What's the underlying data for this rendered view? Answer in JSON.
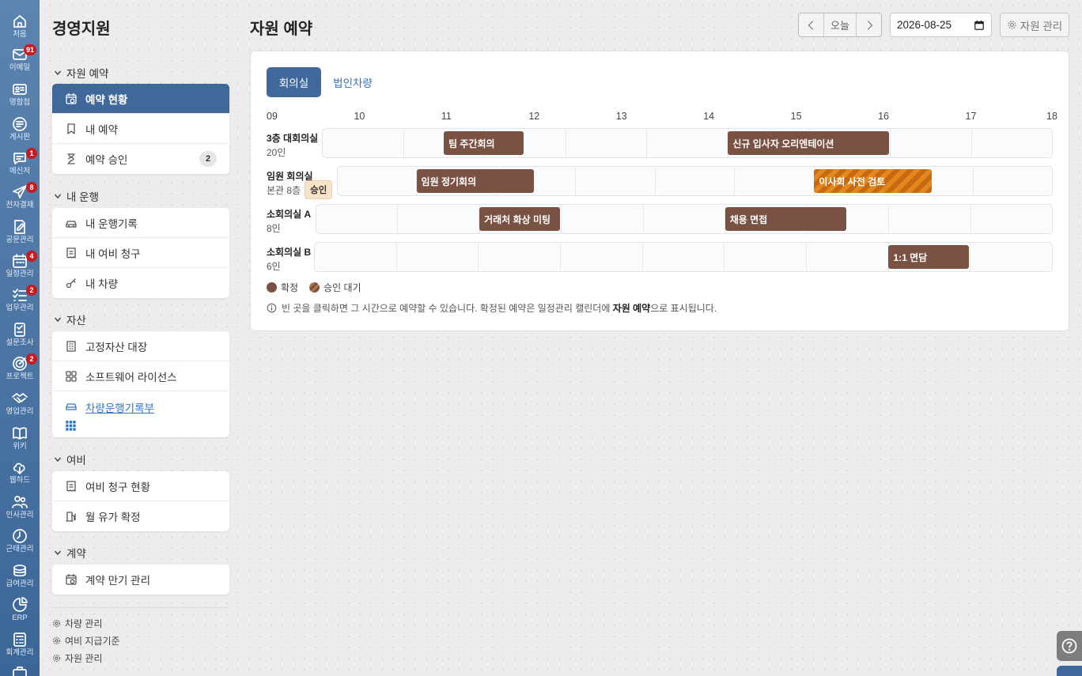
{
  "rail": [
    {
      "label": "처음",
      "icon": "home-icon",
      "badge": ""
    },
    {
      "label": "이메일",
      "icon": "mail-icon",
      "badge": "91"
    },
    {
      "label": "명함첩",
      "icon": "contact-card-icon",
      "badge": ""
    },
    {
      "label": "게시판",
      "icon": "board-icon",
      "badge": ""
    },
    {
      "label": "메신저",
      "icon": "messenger-icon",
      "badge": "1"
    },
    {
      "label": "전자결재",
      "icon": "paper-plane-icon",
      "badge": "8"
    },
    {
      "label": "공문관리",
      "icon": "document-edit-icon",
      "badge": ""
    },
    {
      "label": "일정관리",
      "icon": "calendar-icon",
      "badge": "4"
    },
    {
      "label": "업무관리",
      "icon": "task-list-icon",
      "badge": "2"
    },
    {
      "label": "설문조사",
      "icon": "survey-icon",
      "badge": ""
    },
    {
      "label": "프로젝트",
      "icon": "target-icon",
      "badge": "2"
    },
    {
      "label": "영업관리",
      "icon": "handshake-icon",
      "badge": ""
    },
    {
      "label": "위키",
      "icon": "book-icon",
      "badge": ""
    },
    {
      "label": "웹하드",
      "icon": "cloud-icon",
      "badge": ""
    },
    {
      "label": "인사관리",
      "icon": "people-icon",
      "badge": ""
    },
    {
      "label": "근태관리",
      "icon": "clock-icon",
      "badge": ""
    },
    {
      "label": "급여관리",
      "icon": "coins-icon",
      "badge": ""
    },
    {
      "label": "ERP",
      "icon": "pie-chart-icon",
      "badge": ""
    },
    {
      "label": "회계관리",
      "icon": "calculator-icon",
      "badge": ""
    }
  ],
  "sidebar": {
    "title": "경영지원",
    "groups": [
      {
        "label": "자원 예약",
        "items": [
          {
            "label": "예약 현황",
            "count": ""
          },
          {
            "label": "내 예약",
            "count": ""
          },
          {
            "label": "예약 승인",
            "count": "2"
          }
        ]
      },
      {
        "label": "내 운행",
        "items": [
          {
            "label": "내 운행기록"
          },
          {
            "label": "내 여비 청구"
          },
          {
            "label": "내 차량"
          }
        ]
      },
      {
        "label": "자산",
        "items": [
          {
            "label": "고정자산 대장"
          },
          {
            "label": "소프트웨어 라이선스"
          },
          {
            "label": "차량운행기록부"
          }
        ]
      },
      {
        "label": "여비",
        "items": [
          {
            "label": "여비 청구 현황"
          },
          {
            "label": "월 유가 확정"
          }
        ]
      },
      {
        "label": "계약",
        "items": [
          {
            "label": "계약 만기 관리"
          }
        ]
      }
    ],
    "footer": [
      "차량 관리",
      "여비 지급기준",
      "자원 관리"
    ]
  },
  "main": {
    "title": "자원 예약",
    "today_label": "오늘",
    "date_value": "2026-08-25",
    "manage_label": "자원 관리",
    "tabs": [
      "회의실",
      "법인차량"
    ],
    "hours": [
      "09",
      "10",
      "11",
      "12",
      "13",
      "14",
      "15",
      "16",
      "17",
      "18"
    ],
    "rooms": [
      {
        "name": "3층 대회의실",
        "sub": "20인",
        "badge": "",
        "events": [
          {
            "title": "팀 주간회의",
            "start": 10.5,
            "end": 11.5,
            "status": "confirmed"
          },
          {
            "title": "신규 입사자 오리엔테이션",
            "start": 14.0,
            "end": 16.0,
            "status": "confirmed"
          }
        ]
      },
      {
        "name": "임원 회의실",
        "sub": "본관 8층",
        "badge": "승인",
        "events": [
          {
            "title": "임원 정기회의",
            "start": 10.0,
            "end": 11.5,
            "status": "confirmed"
          },
          {
            "title": "이사회 사전 검토",
            "start": 15.0,
            "end": 16.5,
            "status": "pending"
          }
        ]
      },
      {
        "name": "소회의실 A",
        "sub": "8인",
        "badge": "",
        "events": [
          {
            "title": "거래처 화상 미팅",
            "start": 11.0,
            "end": 12.0,
            "status": "confirmed"
          },
          {
            "title": "채용 면접",
            "start": 14.0,
            "end": 15.5,
            "status": "confirmed"
          }
        ]
      },
      {
        "name": "소회의실 B",
        "sub": "6인",
        "badge": "",
        "events": [
          {
            "title": "1:1 면담",
            "start": 16.0,
            "end": 17.0,
            "status": "confirmed"
          }
        ]
      }
    ],
    "legend": {
      "confirmed": "확정",
      "pending": "승인 대기"
    },
    "hint_pre": "빈 곳을 클릭하면 그 시간으로 예약할 수 있습니다. 확정된 예약은 일정관리 캘린더에 ",
    "hint_bold": "자원 예약",
    "hint_post": "으로 표시됩니다."
  }
}
